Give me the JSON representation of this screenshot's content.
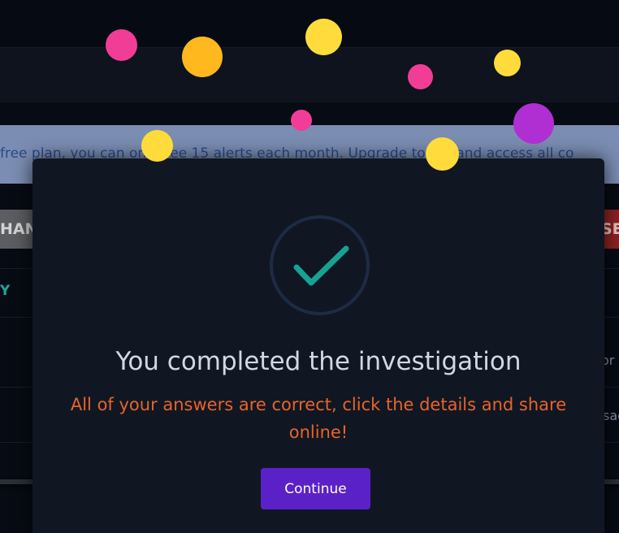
{
  "notice": {
    "text": "free plan, you can only see 15 alerts each month. Upgrade to VIP and access all co"
  },
  "toolbar": {
    "left_button_label": "HAN",
    "right_button_label": "SE"
  },
  "table": {
    "row_mark": "Y",
    "side_text_1": "or",
    "side_text_2": "sac"
  },
  "modal": {
    "icon": "checkmark-icon",
    "title": "You completed the investigation",
    "subtitle": "All of your answers are correct, click the details and share online!",
    "continue_label": "Continue"
  },
  "colors": {
    "modal_bg": "#101722",
    "check": "#16a394",
    "subtitle": "#e8632d",
    "button": "#5b21c9",
    "confetti_pink": "#f23d96",
    "confetti_orange": "#ffb81e",
    "confetti_yellow": "#ffdc3b",
    "confetti_purple": "#b02fd2"
  }
}
